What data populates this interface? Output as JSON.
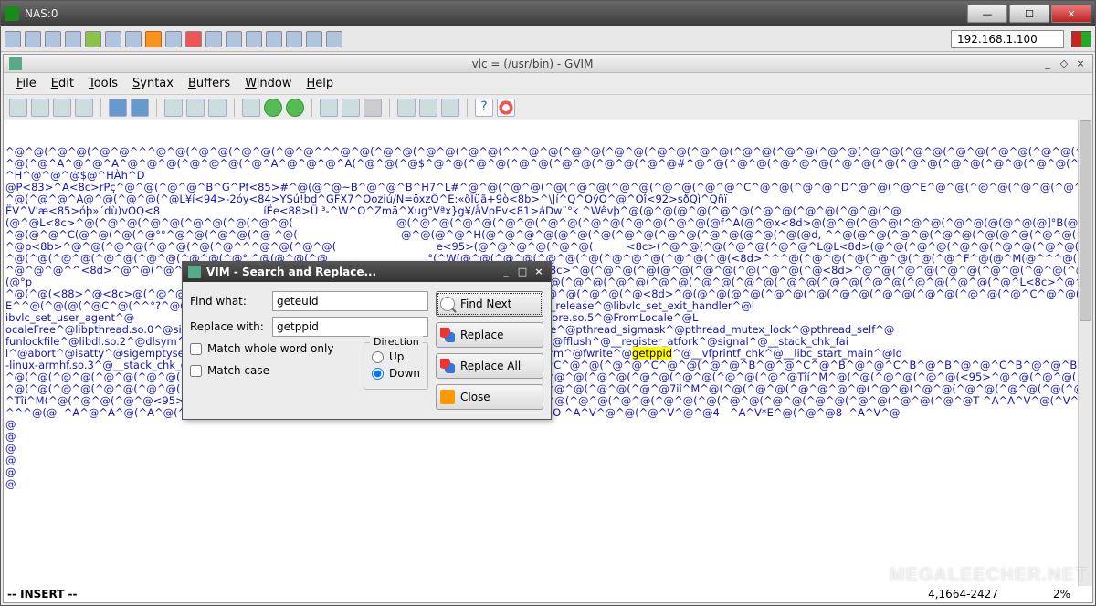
{
  "outer": {
    "title": "NAS:0",
    "ip": "192.168.1.100"
  },
  "gvim": {
    "title": "vlc = (/usr/bin) - GVIM",
    "menus": [
      "File",
      "Edit",
      "Tools",
      "Syntax",
      "Buffers",
      "Window",
      "Help"
    ]
  },
  "editor": {
    "content_lines": [
      "^@^@(^@^@(^@^@^^^@^@(^@^@(^@^@(^@^@^^^@^@(^@^@(^@^@(^@^@(^^^@^@(^@^@(^@^@(^@^@(^@^@(^@^@(^@^@(^@^@(^@^@(^@^@(^@^@(^@^@(^@^@(^@^@(^@^@(^@^@(^@^@(^@^@(^@^@(^@^@(^@^@(^@^@(^@^@(^@^@(^@^@(^@^@(^@^@(^@^@(^@^@(^@^@(^@^@(^@^@(^@^@(^@^@(^@^@(^@^@(^@^@(^@^@(^@",
      "^@(^@^A^@^@^A^@^@^@(^@^@^@(^@^A^@^@^@^A(^@^@(^@$^@^@(^@^@(^@^@(^@^@(^@^@(^@^@#^@^@(^@^@(^@^@^@(^@^@(^@(^@^@(^@^@(^@^@(^@^@(^@(^@^@(^@^@(^@^@(^@^@(^@^@(^@^@(^@^@(^@^@(^@^@(^@^@(^@^@(^@^@(^@^@(^@^@(^@^@(^@^@(^@^@(^@^@(^@^@(^@^@(^@^@(^@^@(^@^@(^@^@(^@^@(",
      "^H^@^@^@$@^HÀh^D",
      "@P<83>^A<8c>rPç^@^@(^@^@^B^G^Pf<85>#^@(@^@~B^@^@^B^H7^L#^@^@(^@^@(^@(^@^@(^@^@(^@^@(^@^@^C^@^@(^@^@^D^@^@(^@^E^@^@(^@^@(^@^@(^@^@(^@^@(^@^@(^@^@(^@^@(      ^@(^@^@(",
      "^@(^@^@^A@^@(^@^@(^@L¥í<94>-2óy<84>YSú!bd^GFX7^Ooziú/N=öxzÔ^E:«õÏüã+9ò<8b>^\\|í^Q^OýO^@^Oî<92>sðQì^Qñï",
      "ËV^V'æ<85>óþ»´dù)vOQ<8                               íËe<88>Ü ³-^W^O^Zmä^Xug°Vªx}g¥/åVpEv<81>áDw¨°k ^Wêvþ^@(@^@(@^@(^@^@(^@^@(^@^@(^@^@(^@",
      "(@^@L<8c>^@(^@^@(^@^@(^@^@(^@(^@^@(                               @(^@^@(^@^@(^@^@(^@^@(^@^@(^@^@(^@^@(@f^A(@^@x<8d>@(@^@(^@^@(^@^@(^@^@(@(@^@(@]°B(@^@^D<8c>^@(",
      "^@(@^@^C(@^@(^@(^@°°^@^@(^@^@(^@ ^@(                               @^@(@^@^H(@^@^@^@(@^@(^@(^@^@(^@^@(^@^@(@^@(^@(@d, ^^@(@^@(^@^@(^@^@(^@(@^@(^@^@(^@^@(@",
      "^@p<8b>^@^@(^@^@(^@^@(^@(^@^^^@^@(^@^@(                              e<95>(@^@^@^@(^@^@(          <8c>(^@^@(^@(^@^@(^@^@^L@L<8d>(@^@(^@^@(^@^@(^@^@(^@^@(^@^@(^@",
      "^@(^@(^@^@(^@^@(^@^@(^@^@(^@° ^@(@^@(^@                              °(^W(@^@(^@^@(^@^@(^@(^@^@^@(^@^@(^@(<8d>^^^@(^@^@(^@(^@^@(^@(^@^F^@(@^M(@^^^@(^@^@^@(^@^@(@",
      "^@^@^@^^<8d>^@^@(^@^@(^@^@^@(^@^@(^@^@(                              ^@(^@^@(@^@<8c>^@(^@^@(^@(@^@(^@^@(^@(^@^@(^@<8d>^@^@(^@^@(^@^@(^@^@(^@^@(^@^@(^@ (^@^L<8c>^@(^@^@(",
      "(@°p                                                                 @(^^^@^@(^@^@(@(^@^@^L<8c>^@(@^@(^@^@(^@^@(^@^@(^@^@(^@^@(^@^@(^@^@(^@^@(^@^@(^@^@(^@^@(^@^L<8c>^@^@(",
      "^@(^@(<88>^@<8c>@(^@^@(^@^@(^@^^^@^@(                               8d>@(^@^@(^@^@(^@^@(^@^@(^@<8d>^@(@^@(@^@(^@^@(^@(^@^@(^@^@(^@^@(^@^@(^@^C^@^@(^@(^@^@(^@^@(^@^@(^@^@(",
      "E^^@(^@(@(^@C^@(^^°?^@(°^@                                           tart__^@_Jv_RegisterClasses^@libvlc_release^@libvlc_set_exit_handler^@l",
      "ibvlc_set_user_agent^@                                               intf^@libvlc_playlist_play^@libvlc_new^@libvlccore.so.5^@FromLocale^@L",
      "ocaleFree^@libpthread.so.0^@sigaction^@pthread_kill^@pthread_mutex_unlock^@sigwait^@flockfile^@pthread_sigmask^@pthread_mutex_lock^@pthread_self^@",
      "funlockfile^@libdl.so.2^@dlsym^@dlerror^@libstdc++.so.6^@libm.so.6^@libgcc_s.so.1^@libc.so.6^@fflush^@__register_atfork^@signal^@__stack_chk_fai",
      "l^@abort^@isatty^@sigemptyset^@rand_r^@__fprintf_chk^@sigaddset^@stderr^@sigdelset^@alarm^@fwrite^@[HL:getppid]^@__vfprintf_chk^@__libc_start_main^@ld",
      "-linux-armhf.so.3^@__stack_chk_guard^@GLIBC_2.4^@(^@^@(^@^B^@^@(^@^C^@^@(^@^@^C^@^@(^@^@^C^@^@(^@^@^B^@^@^C^@^B^@^@^C^B^@^B^@^@^C^B^@^@^B^@^@(^@^@(^L^@(",
      "^@(^@(^@^@(^@^@(^@^@(^@^@(^@^@(^@(^@^@(^@^@(^@^@(^@^@(^@^@(^@^@(^@^@(^@^@(^@^@(^@^@(^@^@(^@^@Tîí^M^@(^@(^@^@(^@^@(<95>^@^@(^@^@(^@(^^^@^@(^@^@(^@^@(^@^@(^@^@(^@^@(^@^@(",
      "^@(^@(^@^@(^@^@(^@^@(^@^@(^@^@(^@(^@^@(^@^@(^@^@(^@^@(^@^@(^@^@(^@^@(^@^@(^@^@7iî^M^@(^@(^@^@(^@^@^@^@(^@^@(^@^@(^@^@(^@^@(^@(^@^@(^@^@(^@μ^@^@(",
      "^Tîí^M(^@(^@^@(^@^@<95>^B(^@^@(^@^@(^@^@(^@^@(^@^@(^@^@(^@(^@^@(^@^@(^@^@(^@^@(^@^@(^@(^@^@(^@^@(^@^@(^@^@(^@^@(^@^@T ^A^A^V^@(^V^A^@(^V^@^V^@ ^A^V^@ ^A^V^@(^@",
      "^^^@(@  ^A^@^A^@(^A^@(^@^@$ ^@^A^@( ^A^@^@(, ^A^@(^@^@(, ^A^@(^@^@(^@^O ^A^V^@^@(^@^V^@^@4   ^A^V*E^@(^@^@8  ^A^V^@",
      "@",
      "@",
      "@",
      "@",
      "@",
      "@"
    ],
    "highlight_text": "getppid",
    "mode": "-- INSERT --",
    "position": "4,1664-2427",
    "percent": "2%"
  },
  "dialog": {
    "title": "VIM - Search and Replace...",
    "find_label": "Find what:",
    "find_value": "geteuid",
    "replace_label": "Replace with:",
    "replace_value": "getppid",
    "match_word": "Match whole word only",
    "match_case": "Match case",
    "direction_label": "Direction",
    "up": "Up",
    "down": "Down",
    "find_next": "Find Next",
    "replace": "Replace",
    "replace_all": "Replace All",
    "close": "Close"
  },
  "watermark": "MEGALEECHER.NET"
}
